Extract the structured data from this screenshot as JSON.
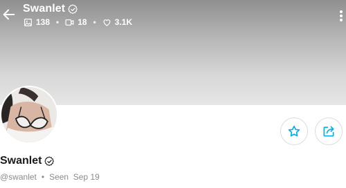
{
  "header": {
    "title": "Swanlet",
    "stats": {
      "photos": "138",
      "videos": "18",
      "likes": "3.1K",
      "separator": "•"
    }
  },
  "profile": {
    "name": "Swanlet",
    "handle": "@swanlet",
    "separator": "•",
    "seen": "Seen  Sep 19"
  },
  "colors": {
    "accent": "#00aff0",
    "header_text": "#ffffff",
    "muted": "#8a8a8a"
  },
  "icons": {
    "back": "arrow-left-icon",
    "verified": "verified-check-icon",
    "photos": "image-icon",
    "videos": "video-icon",
    "likes": "heart-icon",
    "more": "more-vertical-icon",
    "favorite": "star-icon",
    "share": "share-icon"
  }
}
